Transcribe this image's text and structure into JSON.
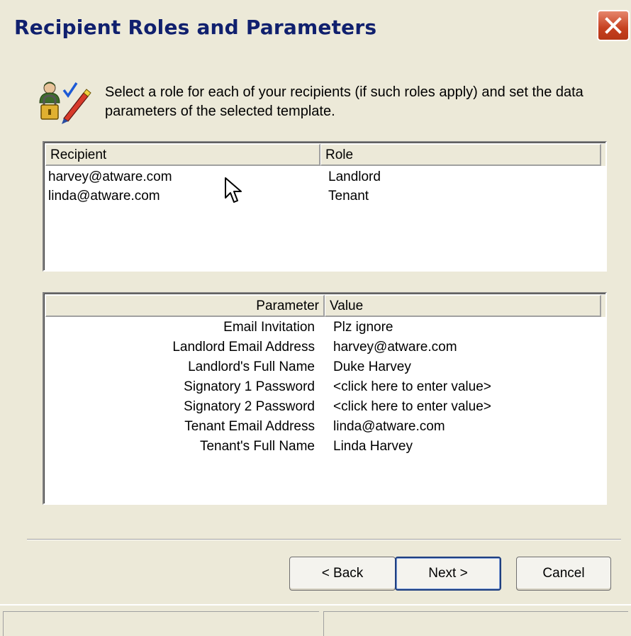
{
  "window": {
    "title": "Recipient Roles and Parameters"
  },
  "intro_text": "Select a role for each of your recipients (if such roles apply) and set the data parameters of the selected template.",
  "recipients_table": {
    "columns": [
      "Recipient",
      "Role"
    ],
    "rows": [
      {
        "recipient": "harvey@atware.com",
        "role": "Landlord"
      },
      {
        "recipient": "linda@atware.com",
        "role": "Tenant"
      }
    ]
  },
  "parameters_table": {
    "columns": [
      "Parameter",
      "Value"
    ],
    "rows": [
      {
        "parameter": "Email Invitation",
        "value": "Plz ignore"
      },
      {
        "parameter": "Landlord Email Address",
        "value": "harvey@atware.com"
      },
      {
        "parameter": "Landlord's Full Name",
        "value": "Duke Harvey"
      },
      {
        "parameter": "Signatory 1 Password",
        "value": "<click here to enter value>"
      },
      {
        "parameter": "Signatory 2 Password",
        "value": "<click here to enter value>"
      },
      {
        "parameter": "Tenant Email Address",
        "value": "linda@atware.com"
      },
      {
        "parameter": "Tenant's Full Name",
        "value": "Linda Harvey"
      }
    ]
  },
  "buttons": {
    "back": "< Back",
    "next": "Next >",
    "cancel": "Cancel"
  },
  "icons": {
    "close": "close-icon",
    "header": "users-lock-pen-icon",
    "cursor": "mouse-cursor-icon"
  },
  "colors": {
    "title": "#10206e",
    "close_button": "#c6401f",
    "dialog_bg": "#ece9d8"
  }
}
